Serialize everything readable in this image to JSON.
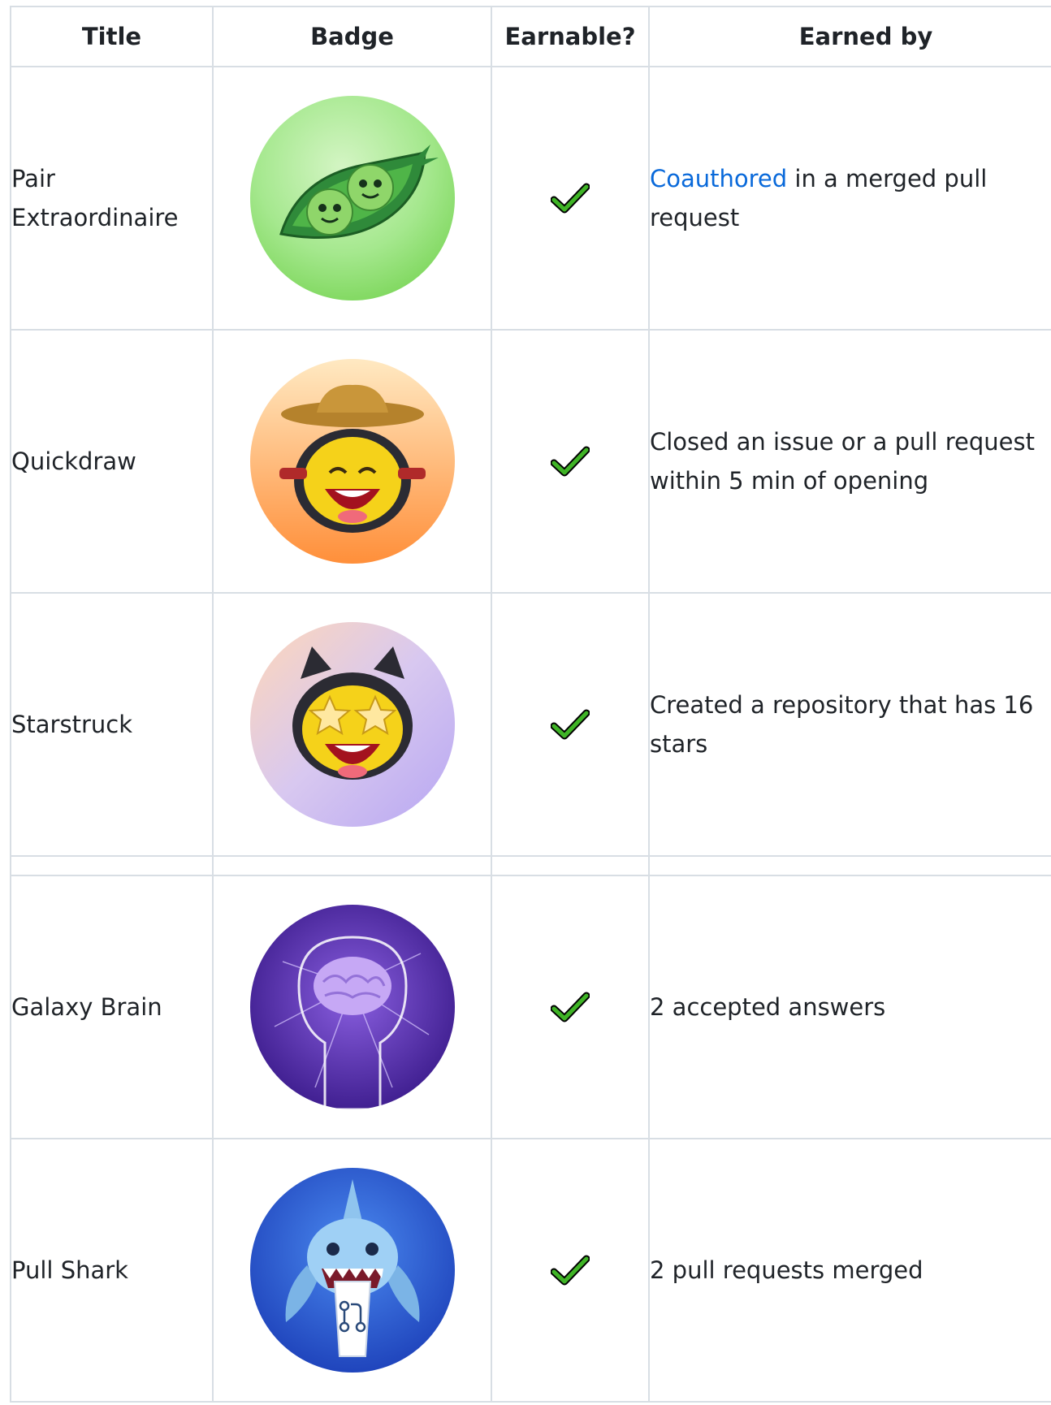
{
  "table": {
    "headers": {
      "title": "Title",
      "badge": "Badge",
      "earnable": "Earnable?",
      "earned_by": "Earned by"
    },
    "rows": [
      {
        "title": "Pair Extraordinaire",
        "badge_icon": "pea-pod-icon",
        "earnable": "check-icon",
        "earned_by_link": "Coauthored",
        "earned_by": " in a merged pull request"
      },
      {
        "title": "Quickdraw",
        "badge_icon": "cowboy-cat-icon",
        "earnable": "check-icon",
        "earned_by": "Closed an issue or a pull request within 5 min of opening"
      },
      {
        "title": "Starstruck",
        "badge_icon": "star-eyes-cat-icon",
        "earnable": "check-icon",
        "earned_by": "Created a repository that has 16 stars"
      },
      {
        "title": "Galaxy Brain",
        "badge_icon": "galaxy-brain-icon",
        "earnable": "check-icon",
        "earned_by": "2 accepted answers"
      },
      {
        "title": "Pull Shark",
        "badge_icon": "shark-icon",
        "earnable": "check-icon",
        "earned_by": "2 pull requests merged"
      }
    ]
  },
  "colors": {
    "border": "#d8dee4",
    "link": "#0969da",
    "text": "#1f2328",
    "check": "#3fb426"
  }
}
